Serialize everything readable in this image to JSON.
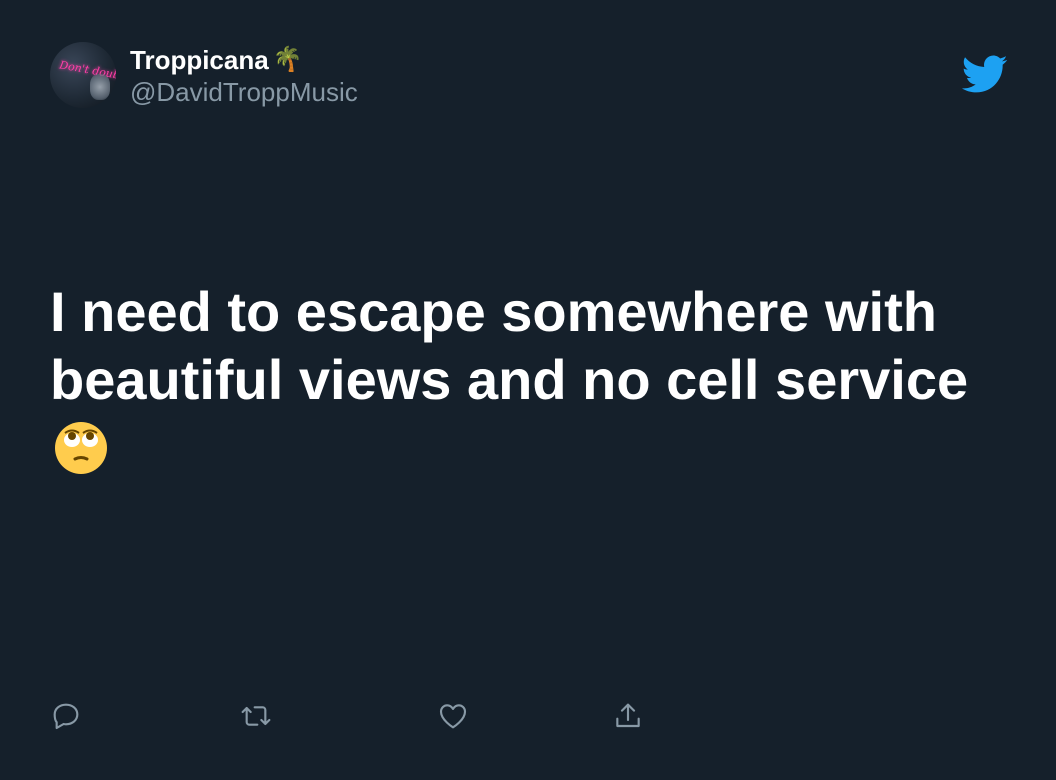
{
  "author": {
    "display_name": "Troppicana",
    "name_emoji": "🌴",
    "handle": "@DavidTroppMusic",
    "avatar_neon_text": "Don't doubt"
  },
  "tweet": {
    "text": "I need to escape somewhere with beautiful views and no cell service",
    "emoji_icon": "face-with-rolling-eyes-emoji"
  },
  "brand": {
    "logo_icon": "twitter-bird-icon",
    "accent_color": "#1da1f2"
  },
  "actions": [
    {
      "name": "reply",
      "icon": "reply-icon"
    },
    {
      "name": "retweet",
      "icon": "retweet-icon"
    },
    {
      "name": "like",
      "icon": "heart-icon"
    },
    {
      "name": "share",
      "icon": "share-icon"
    }
  ],
  "colors": {
    "background": "#15202b",
    "primary_text": "#ffffff",
    "secondary_text": "#8899a6"
  }
}
